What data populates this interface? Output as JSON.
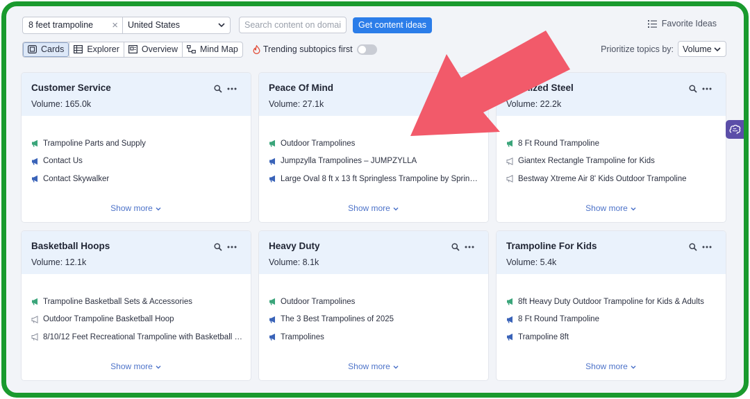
{
  "toolbar": {
    "keyword": "8 feet trampoline",
    "country": "United States",
    "domain_placeholder": "Search content on domain",
    "ideas_button": "Get content ideas",
    "favorite_label": "Favorite Ideas"
  },
  "views": {
    "tabs": [
      {
        "label": "Cards",
        "active": true
      },
      {
        "label": "Explorer",
        "active": false
      },
      {
        "label": "Overview",
        "active": false
      },
      {
        "label": "Mind Map",
        "active": false
      }
    ],
    "trending_label": "Trending subtopics first",
    "trending_on": false,
    "prioritize_label": "Prioritize topics by:",
    "prioritize_value": "Volume"
  },
  "cards": [
    {
      "title": "Customer Service",
      "volume": "Volume: 165.0k",
      "items": [
        {
          "text": "Trampoline Parts and Supply",
          "icon": "megaphone-green"
        },
        {
          "text": "Contact Us",
          "icon": "megaphone-blue"
        },
        {
          "text": "Contact Skywalker",
          "icon": "megaphone-blue"
        }
      ],
      "more": "Show more"
    },
    {
      "title": "Peace Of Mind",
      "volume": "Volume: 27.1k",
      "items": [
        {
          "text": "Outdoor Trampolines",
          "icon": "megaphone-green"
        },
        {
          "text": "Jumpzylla Trampolines – JUMPZYLLA",
          "icon": "megaphone-blue"
        },
        {
          "text": "Large Oval 8 ft x 13 ft Springless Trampoline by Spring…",
          "icon": "megaphone-blue"
        }
      ],
      "more": "Show more"
    },
    {
      "title": "alvanized Steel",
      "volume": "Volume: 22.2k",
      "items": [
        {
          "text": "8 Ft Round Trampoline",
          "icon": "megaphone-green"
        },
        {
          "text": "Giantex Rectangle Trampoline for Kids",
          "icon": "megaphone-outline"
        },
        {
          "text": "Bestway Xtreme Air 8' Kids Outdoor Trampoline",
          "icon": "megaphone-outline"
        }
      ],
      "more": "Show more"
    },
    {
      "title": "Basketball Hoops",
      "volume": "Volume: 12.1k",
      "items": [
        {
          "text": "Trampoline Basketball Sets & Accessories",
          "icon": "megaphone-green"
        },
        {
          "text": "Outdoor Trampoline Basketball Hoop",
          "icon": "megaphone-outline"
        },
        {
          "text": "8/10/12 Feet Recreational Trampoline with Basketball H…",
          "icon": "megaphone-outline"
        }
      ],
      "more": "Show more"
    },
    {
      "title": "Heavy Duty",
      "volume": "Volume: 8.1k",
      "items": [
        {
          "text": "Outdoor Trampolines",
          "icon": "megaphone-green"
        },
        {
          "text": "The 3 Best Trampolines of 2025",
          "icon": "megaphone-blue"
        },
        {
          "text": "Trampolines",
          "icon": "megaphone-blue"
        }
      ],
      "more": "Show more"
    },
    {
      "title": "Trampoline For Kids",
      "volume": "Volume: 5.4k",
      "items": [
        {
          "text": "8ft Heavy Duty Outdoor Trampoline for Kids & Adults",
          "icon": "megaphone-green"
        },
        {
          "text": "8 Ft Round Trampoline",
          "icon": "megaphone-blue"
        },
        {
          "text": "Trampoline 8ft",
          "icon": "megaphone-blue"
        }
      ],
      "more": "Show more"
    }
  ],
  "colors": {
    "frame_border": "#1a9a2e",
    "primary_button": "#2b7de9",
    "card_header": "#eaf2fc",
    "arrow": "#f25a6a",
    "megaphone_green": "#3aa57a",
    "megaphone_blue": "#3a63b8",
    "side_tab": "#5b4ea8"
  }
}
